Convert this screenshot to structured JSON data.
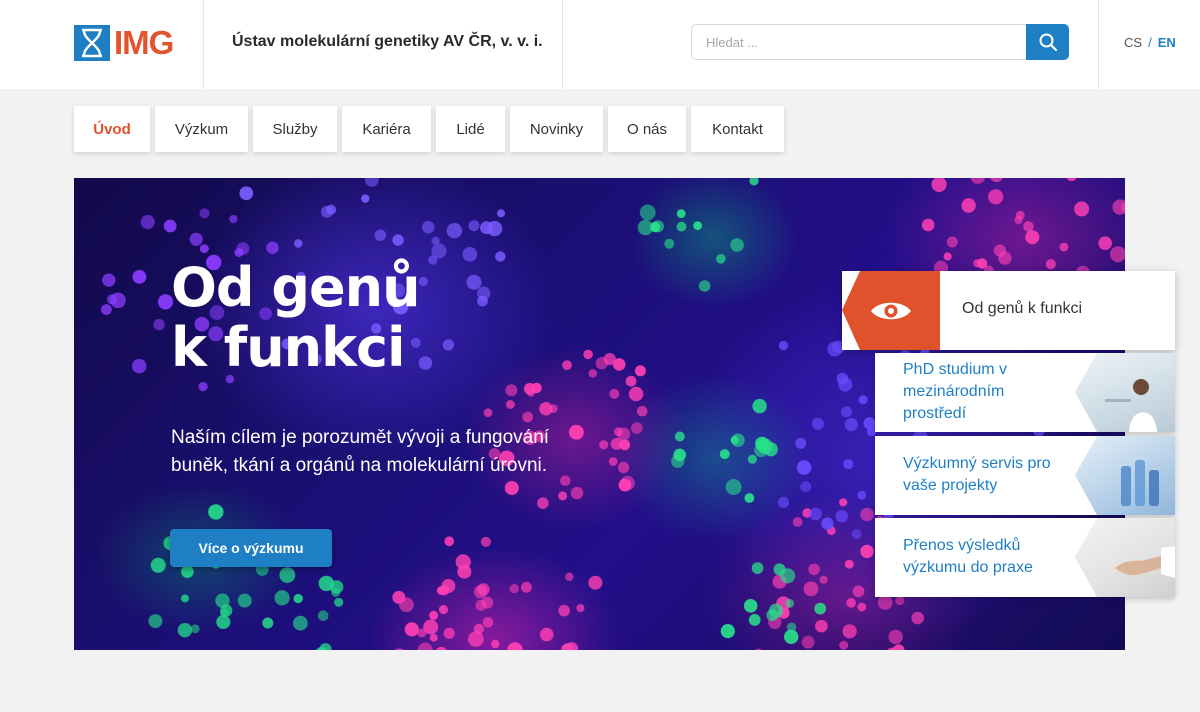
{
  "header": {
    "logo_text": "IMG",
    "institute_name": "Ústav molekulární genetiky AV ČR, v. v. i.",
    "search_placeholder": "Hledat ...",
    "lang": {
      "cs": "CS",
      "separator": "/",
      "en": "EN"
    }
  },
  "nav": {
    "items": [
      "Úvod",
      "Výzkum",
      "Služby",
      "Kariéra",
      "Lidé",
      "Novinky",
      "O nás",
      "Kontakt"
    ],
    "active": "Úvod"
  },
  "hero": {
    "title_line1": "Od genů",
    "title_line2": "k funkci",
    "text": "Naším cílem je porozumět vývoji a fungování buněk, tkání a orgánů na molekulární úrovni.",
    "button": "Více o výzkumu"
  },
  "panel": {
    "head_label": "Od genů k funkci",
    "cards": [
      {
        "label": "PhD studium v mezinárodním prostředí"
      },
      {
        "label": "Výzkumný servis pro vaše projekty"
      },
      {
        "label": "Přenos výsledků výzkumu do praxe"
      }
    ]
  },
  "colors": {
    "accent_blue": "#1f7fc4",
    "accent_orange": "#e0522c",
    "background": "#f2f2f3"
  },
  "icons": [
    "dna-logo-icon",
    "search-icon",
    "eye-icon"
  ]
}
